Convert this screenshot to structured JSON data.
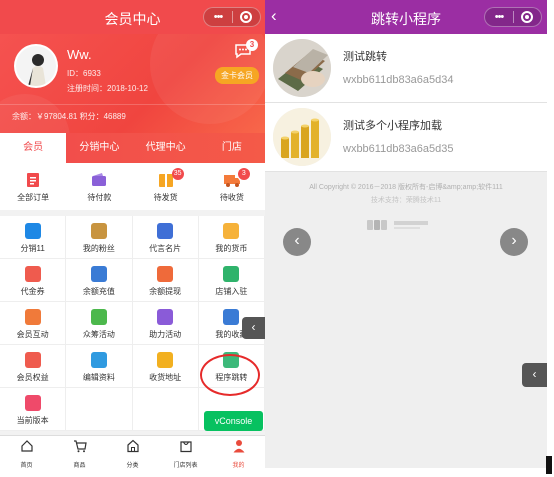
{
  "left": {
    "nav_title": "会员中心",
    "capsule_dots": "•••",
    "profile": {
      "name": "Ww.",
      "id_line": "ID：6933",
      "reg_line": "注册时间：2018-10-12",
      "message_badge": "3",
      "vip_label": "金卡会员",
      "balance_line": "余额：￥97804.81  积分：46889"
    },
    "tabs": [
      "会员",
      "分销中心",
      "代理中心",
      "门店"
    ],
    "orders": [
      {
        "label": "全部订单",
        "icon": "clipboard-icon",
        "color": "#f14a4c",
        "badge": ""
      },
      {
        "label": "待付款",
        "icon": "wallet-icon",
        "color": "#8a60d8",
        "badge": ""
      },
      {
        "label": "待发货",
        "icon": "gift-box-icon",
        "color": "#f6a623",
        "badge": "35"
      },
      {
        "label": "待收货",
        "icon": "truck-icon",
        "color": "#f47a3a",
        "badge": "3"
      }
    ],
    "grid": [
      {
        "label": "分销11",
        "icon": "ranking-icon",
        "color": "#1e88e5"
      },
      {
        "label": "我的粉丝",
        "icon": "fans-icon",
        "color": "#c8943f"
      },
      {
        "label": "代言名片",
        "icon": "card-icon",
        "color": "#3f6fd6"
      },
      {
        "label": "我的货币",
        "icon": "coin-icon",
        "color": "#f6b23a"
      },
      {
        "label": "代金券",
        "icon": "voucher-icon",
        "color": "#ef5b4e"
      },
      {
        "label": "余额充值",
        "icon": "money-bag-icon",
        "color": "#3a7bd5"
      },
      {
        "label": "余额提现",
        "icon": "withdraw-icon",
        "color": "#ef6a3a"
      },
      {
        "label": "店铺入驻",
        "icon": "shop-icon",
        "color": "#2fb36b"
      },
      {
        "label": "会员互动",
        "icon": "interact-icon",
        "color": "#f07a3a"
      },
      {
        "label": "众筹活动",
        "icon": "crowdfund-icon",
        "color": "#4cb84c"
      },
      {
        "label": "助力活动",
        "icon": "boost-icon",
        "color": "#8a5bd8"
      },
      {
        "label": "我的收藏",
        "icon": "star-icon",
        "color": "#3a7bd5"
      },
      {
        "label": "会员权益",
        "icon": "medal-icon",
        "color": "#ef5b4e"
      },
      {
        "label": "编辑资料",
        "icon": "edit-icon",
        "color": "#2f9ae0"
      },
      {
        "label": "收货地址",
        "icon": "location-icon",
        "color": "#f2b020"
      },
      {
        "label": "程序跳转",
        "icon": "jump-icon",
        "color": "#3cb97a"
      },
      {
        "label": "当前版本",
        "icon": "info-icon",
        "color": "#ef4a6a"
      }
    ],
    "vconsole_label": "vConsole",
    "side_tab_arrow": "‹",
    "tabbar": [
      {
        "label": "首页",
        "icon": "home-icon"
      },
      {
        "label": "商品",
        "icon": "cart-icon"
      },
      {
        "label": "分类",
        "icon": "category-icon"
      },
      {
        "label": "门店列表",
        "icon": "store-list-icon"
      },
      {
        "label": "我的",
        "icon": "user-icon"
      }
    ]
  },
  "right": {
    "nav_title": "跳转小程序",
    "back_arrow": "‹",
    "capsule_dots": "•••",
    "programs": [
      {
        "name": "测试跳转",
        "appid": "wxbb611db83a6a5d34"
      },
      {
        "name": "测试多个小程序加载",
        "appid": "wxbb611db83a6a5d35"
      }
    ],
    "copyright": "All Copyright © 2016－2018 版权所有-启博&amp;amp;软件111",
    "support": "技术支持：荣腾技术11",
    "prev_arrow": "‹",
    "next_arrow": "›",
    "side_tab_arrow": "‹"
  }
}
